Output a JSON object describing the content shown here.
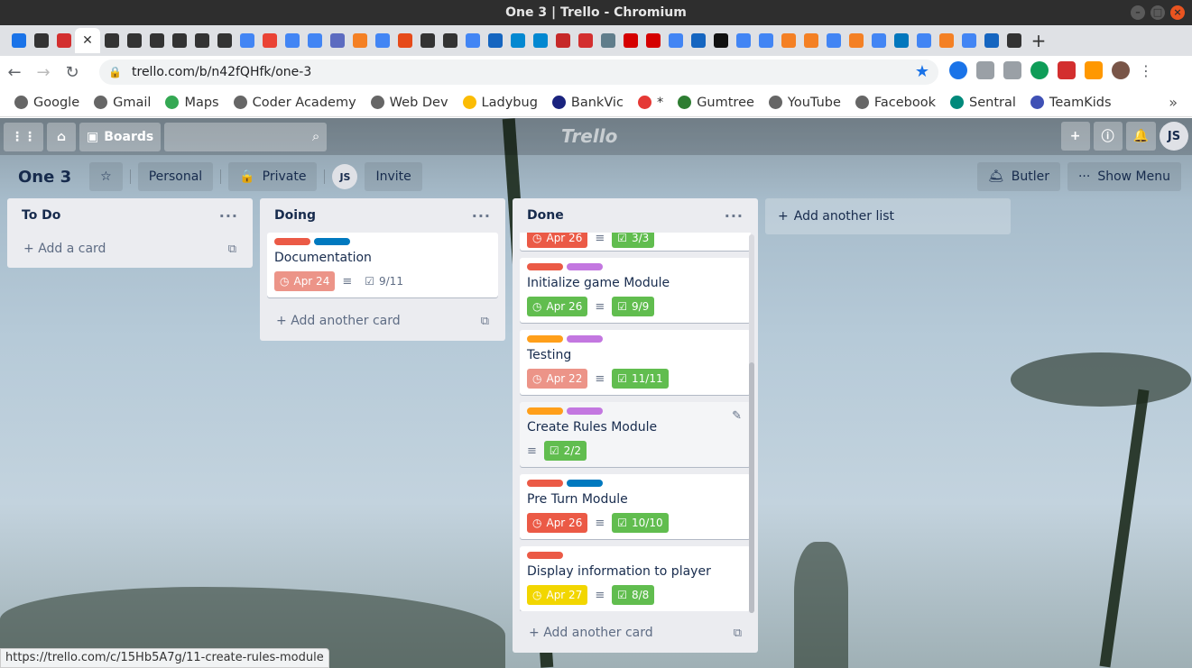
{
  "window": {
    "title": "One 3 | Trello - Chromium"
  },
  "tabs": {
    "count_icons": 46,
    "new_tab": "+"
  },
  "omnibox": {
    "url": "trello.com/b/n42fQHfk/one-3"
  },
  "bookmarks": [
    {
      "label": "Google",
      "color": "#666"
    },
    {
      "label": "Gmail",
      "color": "#666"
    },
    {
      "label": "Maps",
      "color": "#34a853"
    },
    {
      "label": "Coder Academy",
      "color": "#666"
    },
    {
      "label": "Web Dev",
      "color": "#666"
    },
    {
      "label": "Ladybug",
      "color": "#fbbc04"
    },
    {
      "label": "BankVic",
      "color": "#1a237e"
    },
    {
      "label": "*",
      "color": "#e53935"
    },
    {
      "label": "Gumtree",
      "color": "#2e7d32"
    },
    {
      "label": "YouTube",
      "color": "#666"
    },
    {
      "label": "Facebook",
      "color": "#666"
    },
    {
      "label": "Sentral",
      "color": "#00897b"
    },
    {
      "label": "TeamKids",
      "color": "#3f51b5"
    }
  ],
  "topnav": {
    "boards_label": "Boards",
    "logo": "Trello",
    "user_initials": "JS"
  },
  "board": {
    "title": "One 3",
    "team_label": "Personal",
    "visibility_label": "Private",
    "member_initials": "JS",
    "invite_label": "Invite",
    "butler_label": "Butler",
    "menu_label": "Show Menu",
    "add_list_label": "Add another list"
  },
  "lists": {
    "todo": {
      "title": "To Do",
      "add_label": "Add a card"
    },
    "doing": {
      "title": "Doing",
      "add_label": "Add another card",
      "cards": [
        {
          "title": "Documentation",
          "labels": [
            "#eb5a46",
            "#0079bf"
          ],
          "due": "Apr 24",
          "due_color": "#ec9488",
          "checklist": "9/11",
          "checklist_done": false
        }
      ]
    },
    "done": {
      "title": "Done",
      "add_label": "Add another card",
      "partial_card": {
        "due": "Apr 26",
        "checklist": "3/3"
      },
      "cards": [
        {
          "title": "Initialize game Module",
          "labels": [
            "#eb5a46",
            "#c377e0"
          ],
          "due": "Apr 26",
          "due_color": "#61bd4f",
          "checklist": "9/9",
          "checklist_done": true
        },
        {
          "title": "Testing",
          "labels": [
            "#ff9f1a",
            "#c377e0"
          ],
          "due": "Apr 22",
          "due_color": "#ec9488",
          "checklist": "11/11",
          "checklist_done": true
        },
        {
          "title": "Create Rules Module",
          "labels": [
            "#ff9f1a",
            "#c377e0"
          ],
          "due": "",
          "due_color": "",
          "checklist": "2/2",
          "checklist_done": true
        },
        {
          "title": "Pre Turn Module",
          "labels": [
            "#eb5a46",
            "#0079bf"
          ],
          "due": "Apr 26",
          "due_color": "#eb5a46",
          "checklist": "10/10",
          "checklist_done": true
        },
        {
          "title": "Display information to player",
          "labels": [
            "#eb5a46"
          ],
          "due": "Apr 27",
          "due_color": "#f2d600",
          "checklist": "8/8",
          "checklist_done": true
        }
      ]
    }
  },
  "statusbar": {
    "url": "https://trello.com/c/15Hb5A7g/11-create-rules-module"
  }
}
